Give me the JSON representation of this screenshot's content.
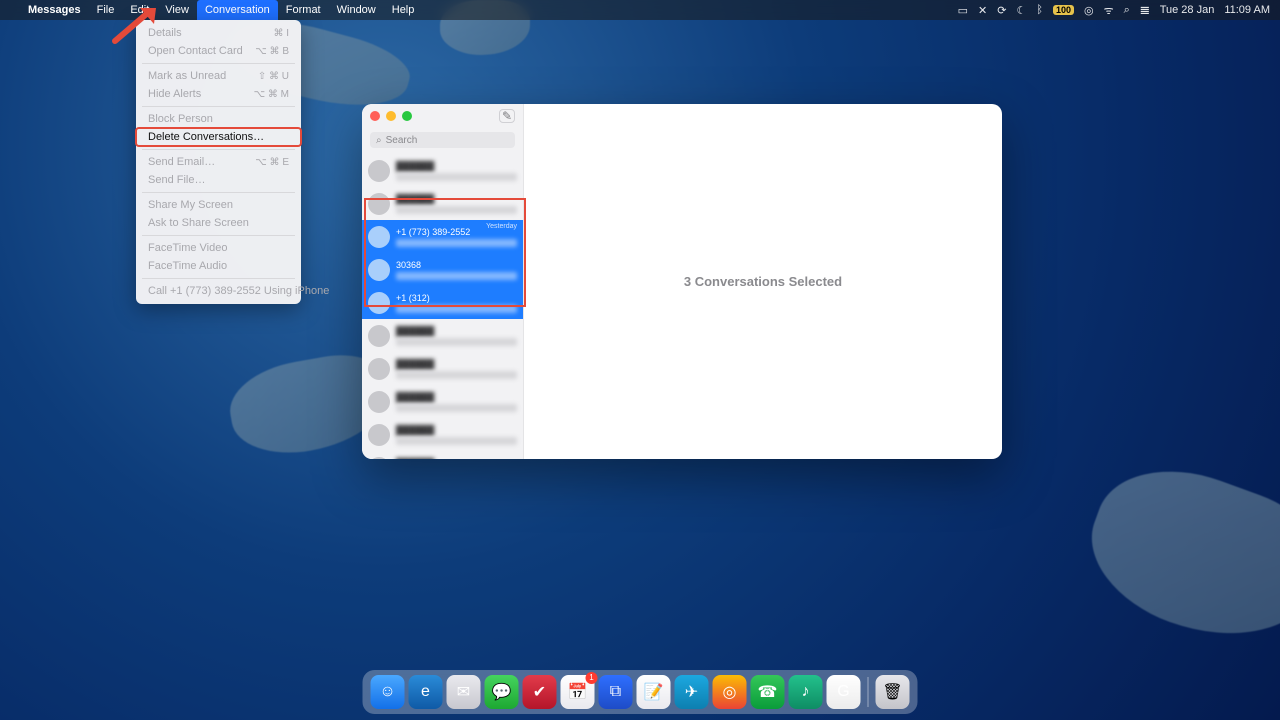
{
  "menubar": {
    "app_name": "Messages",
    "items": [
      "File",
      "Edit",
      "View",
      "Conversation",
      "Format",
      "Window",
      "Help"
    ],
    "open_index": 3,
    "right": {
      "battery_text": "100",
      "date": "Tue 28 Jan",
      "time": "11:09 AM"
    }
  },
  "dropdown": {
    "groups": [
      [
        {
          "label": "Details",
          "shortcut": "⌘ I",
          "disabled": true
        },
        {
          "label": "Open Contact Card",
          "shortcut": "⌥ ⌘ B",
          "disabled": true
        }
      ],
      [
        {
          "label": "Mark as Unread",
          "shortcut": "⇧ ⌘ U",
          "disabled": true
        },
        {
          "label": "Hide Alerts",
          "shortcut": "⌥ ⌘ M",
          "disabled": true
        }
      ],
      [
        {
          "label": "Block Person",
          "shortcut": "",
          "disabled": true
        },
        {
          "label": "Delete Conversations…",
          "shortcut": "",
          "disabled": false,
          "highlight": true
        }
      ],
      [
        {
          "label": "Send Email…",
          "shortcut": "⌥ ⌘ E",
          "disabled": true
        },
        {
          "label": "Send File…",
          "shortcut": "",
          "disabled": true
        }
      ],
      [
        {
          "label": "Share My Screen",
          "shortcut": "",
          "disabled": true
        },
        {
          "label": "Ask to Share Screen",
          "shortcut": "",
          "disabled": true
        }
      ],
      [
        {
          "label": "FaceTime Video",
          "shortcut": "",
          "disabled": true
        },
        {
          "label": "FaceTime Audio",
          "shortcut": "",
          "disabled": true
        }
      ],
      [
        {
          "label": "Call +1 (773) 389-2552 Using iPhone",
          "shortcut": "",
          "disabled": true
        }
      ]
    ]
  },
  "window": {
    "search_placeholder": "Search",
    "main_text": "3 Conversations Selected",
    "conversations": [
      {
        "name": "",
        "selected": false
      },
      {
        "name": "",
        "selected": false
      },
      {
        "name": "+1 (773) 389-2552",
        "selected": true,
        "time": "Yesterday"
      },
      {
        "name": "30368",
        "selected": true,
        "time": ""
      },
      {
        "name": "+1 (312)",
        "selected": true,
        "time": ""
      },
      {
        "name": "",
        "selected": false
      },
      {
        "name": "",
        "selected": false
      },
      {
        "name": "",
        "selected": false
      },
      {
        "name": "",
        "selected": false
      },
      {
        "name": "",
        "selected": false
      }
    ]
  },
  "dock": {
    "apps": [
      {
        "name": "finder",
        "cls": "da1",
        "glyph": "☺"
      },
      {
        "name": "edge",
        "cls": "da2",
        "glyph": "e"
      },
      {
        "name": "mail",
        "cls": "da3",
        "glyph": "✉"
      },
      {
        "name": "messages",
        "cls": "da4",
        "glyph": "💬"
      },
      {
        "name": "todoist",
        "cls": "da5",
        "glyph": "✔"
      },
      {
        "name": "calendar",
        "cls": "da6",
        "glyph": "📅",
        "badge": "1"
      },
      {
        "name": "vscode",
        "cls": "da7",
        "glyph": "⧉"
      },
      {
        "name": "notes",
        "cls": "da8",
        "glyph": "📝"
      },
      {
        "name": "telegram",
        "cls": "da9",
        "glyph": "✈"
      },
      {
        "name": "chrome",
        "cls": "da10",
        "glyph": "◎"
      },
      {
        "name": "whatsapp",
        "cls": "da11",
        "glyph": "☎"
      },
      {
        "name": "spotify",
        "cls": "da12",
        "glyph": "♪"
      },
      {
        "name": "gsuite",
        "cls": "da13",
        "glyph": "G"
      }
    ]
  }
}
